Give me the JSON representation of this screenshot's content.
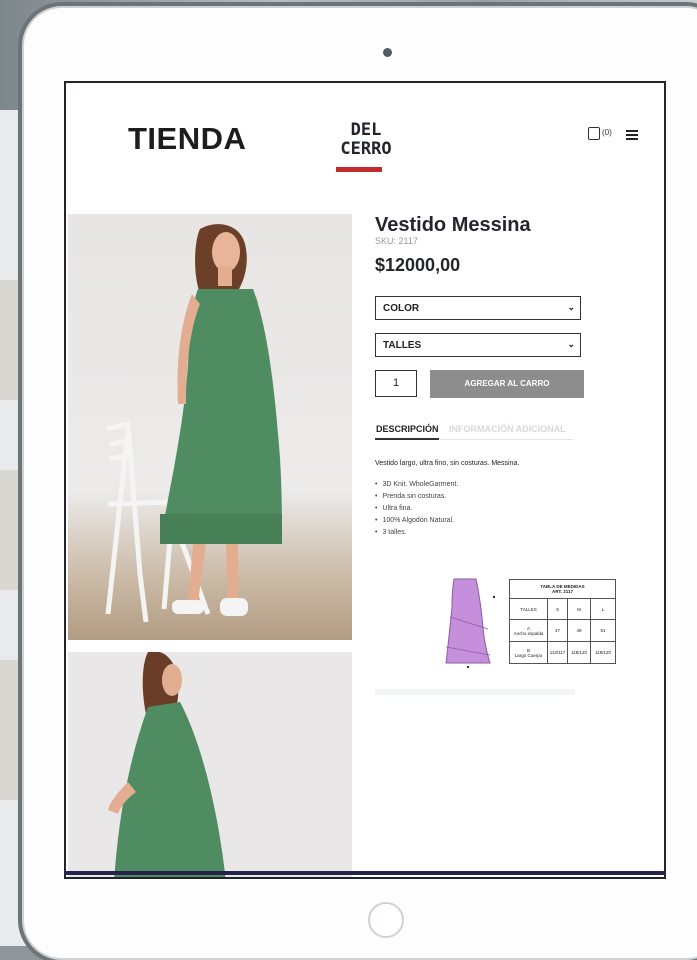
{
  "store": {
    "logo_text": "TIENDA",
    "brand_line1": "DEL",
    "brand_line2": "CERRO",
    "cart_count": "(0)"
  },
  "product": {
    "title": "Vestido Messina",
    "sku": "SKU: 2117",
    "price": "$12000,00"
  },
  "options": {
    "color_label": "COLOR",
    "talles_label": "TALLES",
    "quantity": "1",
    "add_to_cart": "AGREGAR AL CARRO"
  },
  "tabs": {
    "description": "DESCRIPCIÓN",
    "additional_info": "INFORMACIÓN ADICIONAL"
  },
  "description": {
    "intro": "Vestido largo, ultra fino, sin costuras. Messina.",
    "features": [
      "3D Knit. WholeGarment.",
      "Prenda sin costuras.",
      "Ultra fina.",
      "100% Algodón Natural.",
      "3 talles."
    ]
  },
  "size_table": {
    "title": "TABLA DE MEDIDAS",
    "subtitle": "ART. 2117",
    "header": [
      "TALLES",
      "S",
      "M",
      "L"
    ],
    "row_a": {
      "label": "A",
      "sublabel": "Ancho espalda",
      "values": [
        "47",
        "49",
        "51"
      ]
    },
    "row_b": {
      "label": "B",
      "sublabel": "Largo Cuerpo",
      "values": [
        "113/117",
        "118/120",
        "119/120"
      ]
    }
  },
  "colors": {
    "brand_red": "#c22b2b",
    "button_gray": "#8d8d8d",
    "dress_green": "#4f8c62",
    "chart_lilac": "#c58fdc"
  }
}
